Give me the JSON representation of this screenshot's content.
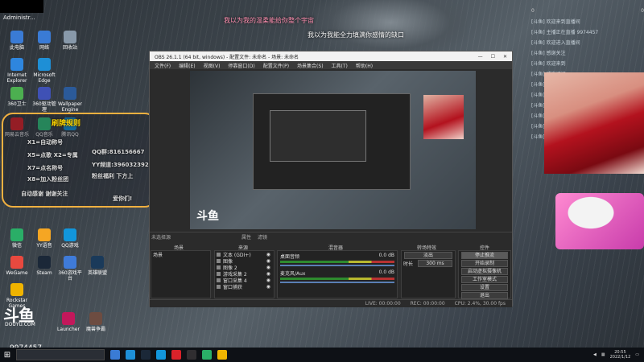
{
  "desktop": {
    "admin_label": "Administr...",
    "icons": [
      {
        "label": "此电脑",
        "color": "#3a7bd5"
      },
      {
        "label": "网络",
        "color": "#3a7bd5"
      },
      {
        "label": "回收站",
        "color": "#8899aa"
      },
      {
        "label": "Internet Explorer",
        "color": "#2e86de"
      },
      {
        "label": "Microsoft Edge",
        "color": "#1e8fd6"
      },
      {
        "label": "360卫士",
        "color": "#4caf50"
      },
      {
        "label": "360驱动管理",
        "color": "#3f51b5"
      },
      {
        "label": "Wallpaper Engine",
        "color": "#2b5a99"
      },
      {
        "label": "网易云音乐",
        "color": "#d9222a"
      },
      {
        "label": "QQ音乐",
        "color": "#31c27c"
      },
      {
        "label": "腾讯QQ",
        "color": "#1296db"
      },
      {
        "label": "微信",
        "color": "#2aae67"
      },
      {
        "label": "YY语音",
        "color": "#f5a623"
      },
      {
        "label": "QQ游戏",
        "color": "#1296db"
      },
      {
        "label": "WeGame",
        "color": "#e8493f"
      },
      {
        "label": "Steam",
        "color": "#1b2838"
      },
      {
        "label": "360游戏平台",
        "color": "#3f7bd9"
      },
      {
        "label": "英雄联盟",
        "color": "#1a3a5a"
      },
      {
        "label": "Rockstar Games",
        "color": "#f0b400"
      },
      {
        "label": "Launcher",
        "color": "#c2185b"
      },
      {
        "label": "魔兽争霸",
        "color": "#6d4c41"
      }
    ]
  },
  "wallpaper_text": {
    "line1": "我以为我的温柔能给你整个宇宙",
    "line2": "我以为我能全力填满你感情的缺口"
  },
  "sticker": {
    "header": "刷牌规则",
    "lines": [
      {
        "text": "X1=自动称号",
        "color": "#ffd700"
      },
      {
        "text": "X5=点歌  X2=专属",
        "color": "#ffd700"
      },
      {
        "text": "X7=点名称号",
        "color": "#ffd700"
      },
      {
        "text": "X8=加入粉丝团",
        "color": "#ffd700"
      },
      {
        "text": "QQ群:816156667",
        "color": "#ff6fa0"
      },
      {
        "text": "YY频道:3960323921",
        "color": "#ff6fa0"
      },
      {
        "text": "粉丝福利 下方上",
        "color": "#ffd700"
      },
      {
        "text": "自动感谢 谢谢关注",
        "color": "#ff6fa0"
      },
      {
        "text": "爱你们!",
        "color": "#ffd700"
      }
    ]
  },
  "chat": {
    "header_left": "0",
    "header_right": "0",
    "lines": [
      "[斗鱼] 欢迎来到直播间",
      "[斗鱼] 主播正在直播 9974457",
      "[斗鱼] 欢迎进入直播间",
      "[斗鱼] 感谢关注",
      "[斗鱼] 欢迎来到",
      "[斗鱼] 感谢订阅",
      "[斗鱼] 欢迎",
      "[斗鱼] 欢迎来到",
      "[斗鱼] 感谢",
      "[斗鱼] 欢迎来到",
      "[斗鱼] 感谢",
      "[斗鱼] 欢迎来到"
    ]
  },
  "obs": {
    "title": "OBS 26.1.1 (64 bit, windows) - 配置文件: 未命名 - 场景: 未命名",
    "menu": [
      "文件(F)",
      "编辑(E)",
      "视图(V)",
      "停靠窗口(D)",
      "配置文件(P)",
      "场景集合(S)",
      "工具(T)",
      "帮助(H)"
    ],
    "context_bar": {
      "label": "未选择源",
      "properties": "属性",
      "filters": "滤镜"
    },
    "docks": {
      "scenes": {
        "title": "场景",
        "items": [
          "场景"
        ]
      },
      "sources": {
        "title": "来源",
        "items": [
          "文本 (GDI+)",
          "图像",
          "图像 2",
          "游戏采集 2",
          "窗口采集 4",
          "窗口捕获"
        ]
      },
      "mixer": {
        "title": "混音器",
        "channels": [
          {
            "name": "桌面音频",
            "db": "0.0 dB"
          },
          {
            "name": "麦克风/Aux",
            "db": "0.0 dB"
          }
        ]
      },
      "transitions": {
        "title": "转场特效",
        "type": "淡出",
        "duration_label": "时长",
        "duration": "300 ms"
      },
      "controls": {
        "title": "控件",
        "buttons": [
          "停止推流",
          "开始录制",
          "启动虚拟摄像机",
          "工作室模式",
          "设置",
          "退出"
        ]
      }
    },
    "status": {
      "live": "LIVE: 00:00:00",
      "rec": "REC: 00:00:00",
      "cpu": "CPU: 2.4%, 30.00 fps"
    },
    "preview_logo": "斗鱼"
  },
  "logo": {
    "main": "斗鱼",
    "sub": "DOUYU.COM",
    "room_id": "9974457"
  },
  "taskbar": {
    "time": "20:55",
    "date": "2022/1/12"
  }
}
